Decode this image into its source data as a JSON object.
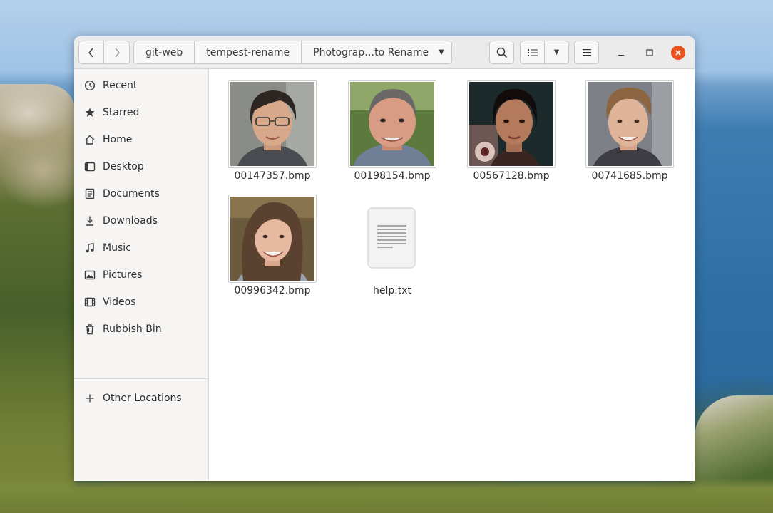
{
  "window": {
    "breadcrumbs": [
      "git-web",
      "tempest-rename",
      "Photograp…to Rename"
    ]
  },
  "sidebar": {
    "items": [
      {
        "label": "Recent",
        "icon": "clock-icon"
      },
      {
        "label": "Starred",
        "icon": "star-icon"
      },
      {
        "label": "Home",
        "icon": "home-icon"
      },
      {
        "label": "Desktop",
        "icon": "desktop-icon"
      },
      {
        "label": "Documents",
        "icon": "document-icon"
      },
      {
        "label": "Downloads",
        "icon": "download-icon"
      },
      {
        "label": "Music",
        "icon": "music-icon"
      },
      {
        "label": "Pictures",
        "icon": "picture-icon"
      },
      {
        "label": "Videos",
        "icon": "video-icon"
      },
      {
        "label": "Rubbish Bin",
        "icon": "trash-icon"
      }
    ],
    "other_locations": "Other Locations"
  },
  "files": [
    {
      "name": "00147357.bmp",
      "kind": "image-thumbnail"
    },
    {
      "name": "00198154.bmp",
      "kind": "image-thumbnail"
    },
    {
      "name": "00567128.bmp",
      "kind": "image-thumbnail"
    },
    {
      "name": "00741685.bmp",
      "kind": "image-thumbnail"
    },
    {
      "name": "00996342.bmp",
      "kind": "image-thumbnail"
    },
    {
      "name": "help.txt",
      "kind": "text-file-icon"
    }
  ],
  "colors": {
    "close_button": "#e95420",
    "headerbar": "#ebebeb",
    "sidebar": "#f6f5f4"
  }
}
